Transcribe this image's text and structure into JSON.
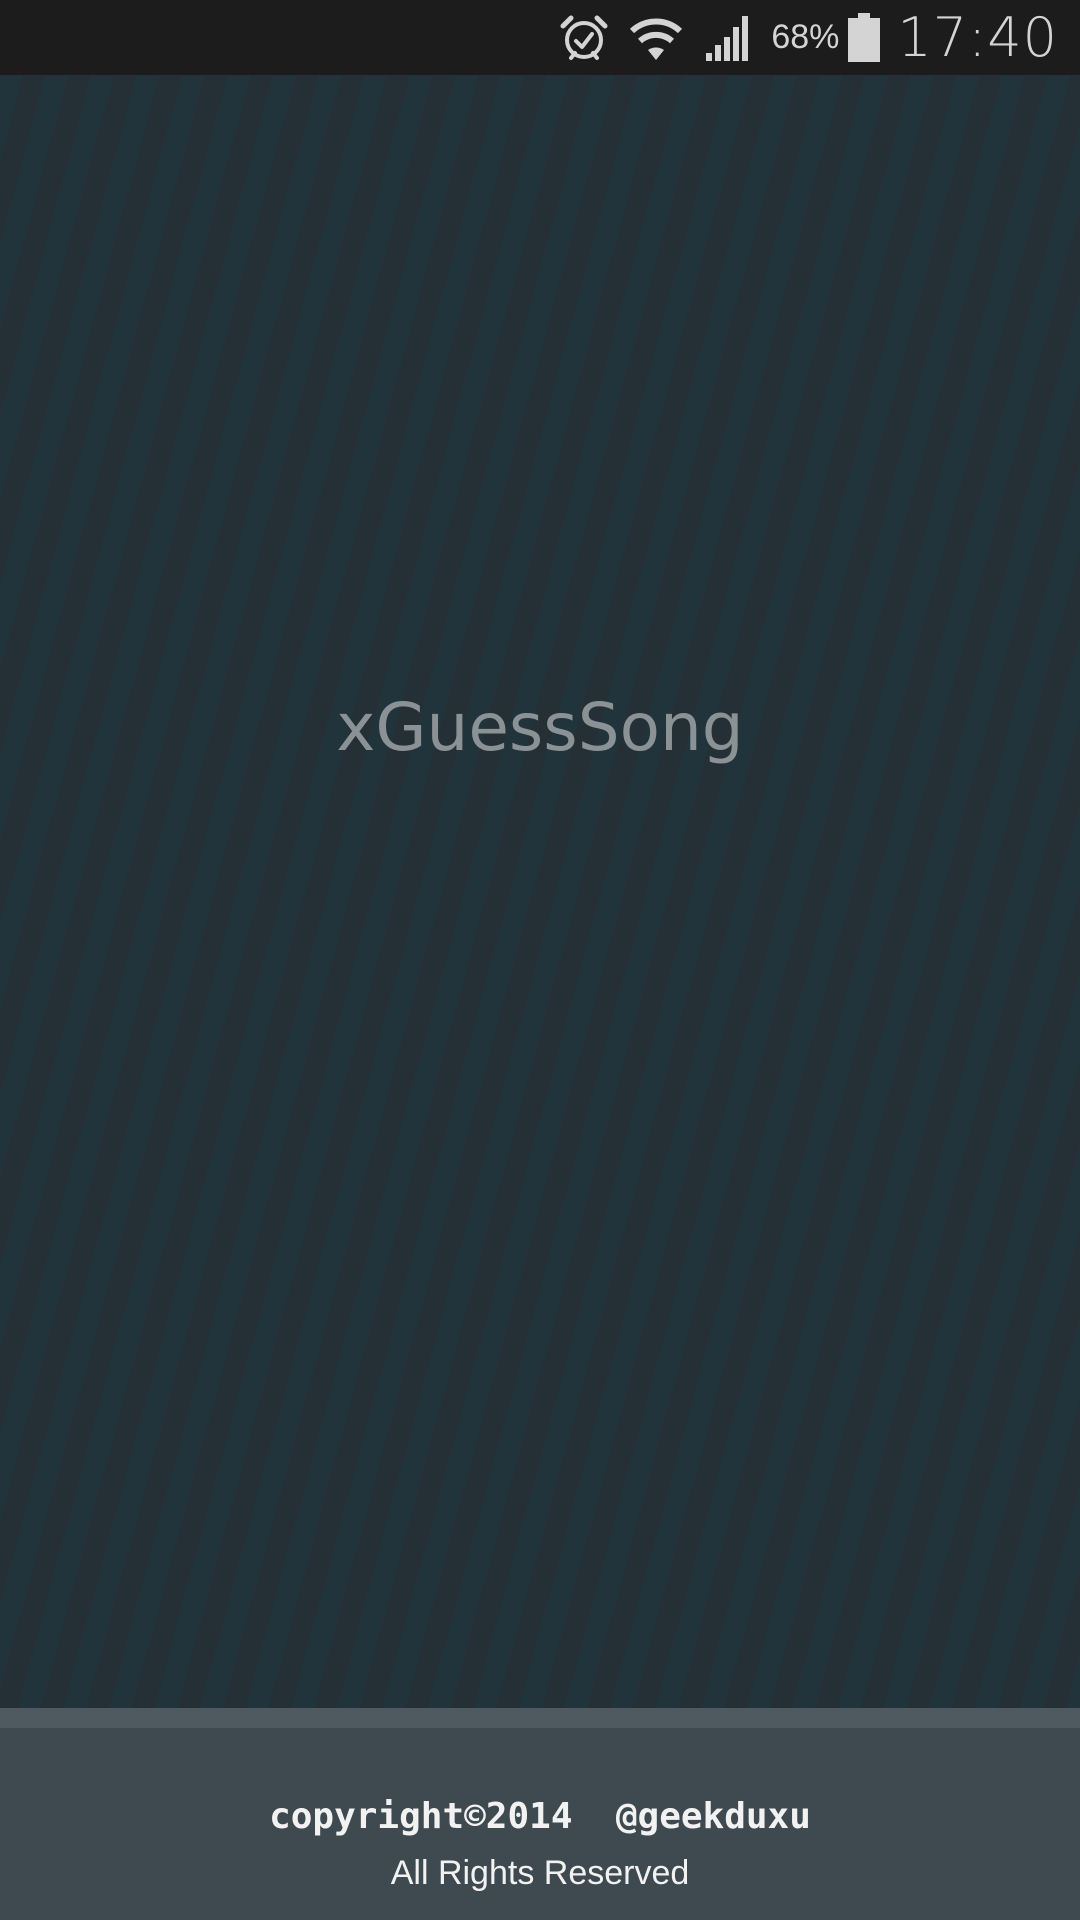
{
  "status_bar": {
    "battery_percent": "68%",
    "time": "17:40",
    "icons": [
      "alarm-clock-icon",
      "wifi-icon",
      "cellular-signal-icon",
      "battery-icon"
    ]
  },
  "splash": {
    "title": "xGuessSong"
  },
  "footer": {
    "copyright": "copyright©2014  @geekduxu",
    "rights": "All Rights Reserved"
  },
  "colors": {
    "background": "#233137",
    "stripe_light": "#22343b",
    "stripe_dark": "#253036",
    "footer_bg": "#3f4a50",
    "footer_divider": "#4e5a60",
    "title_text": "#8a9296"
  }
}
